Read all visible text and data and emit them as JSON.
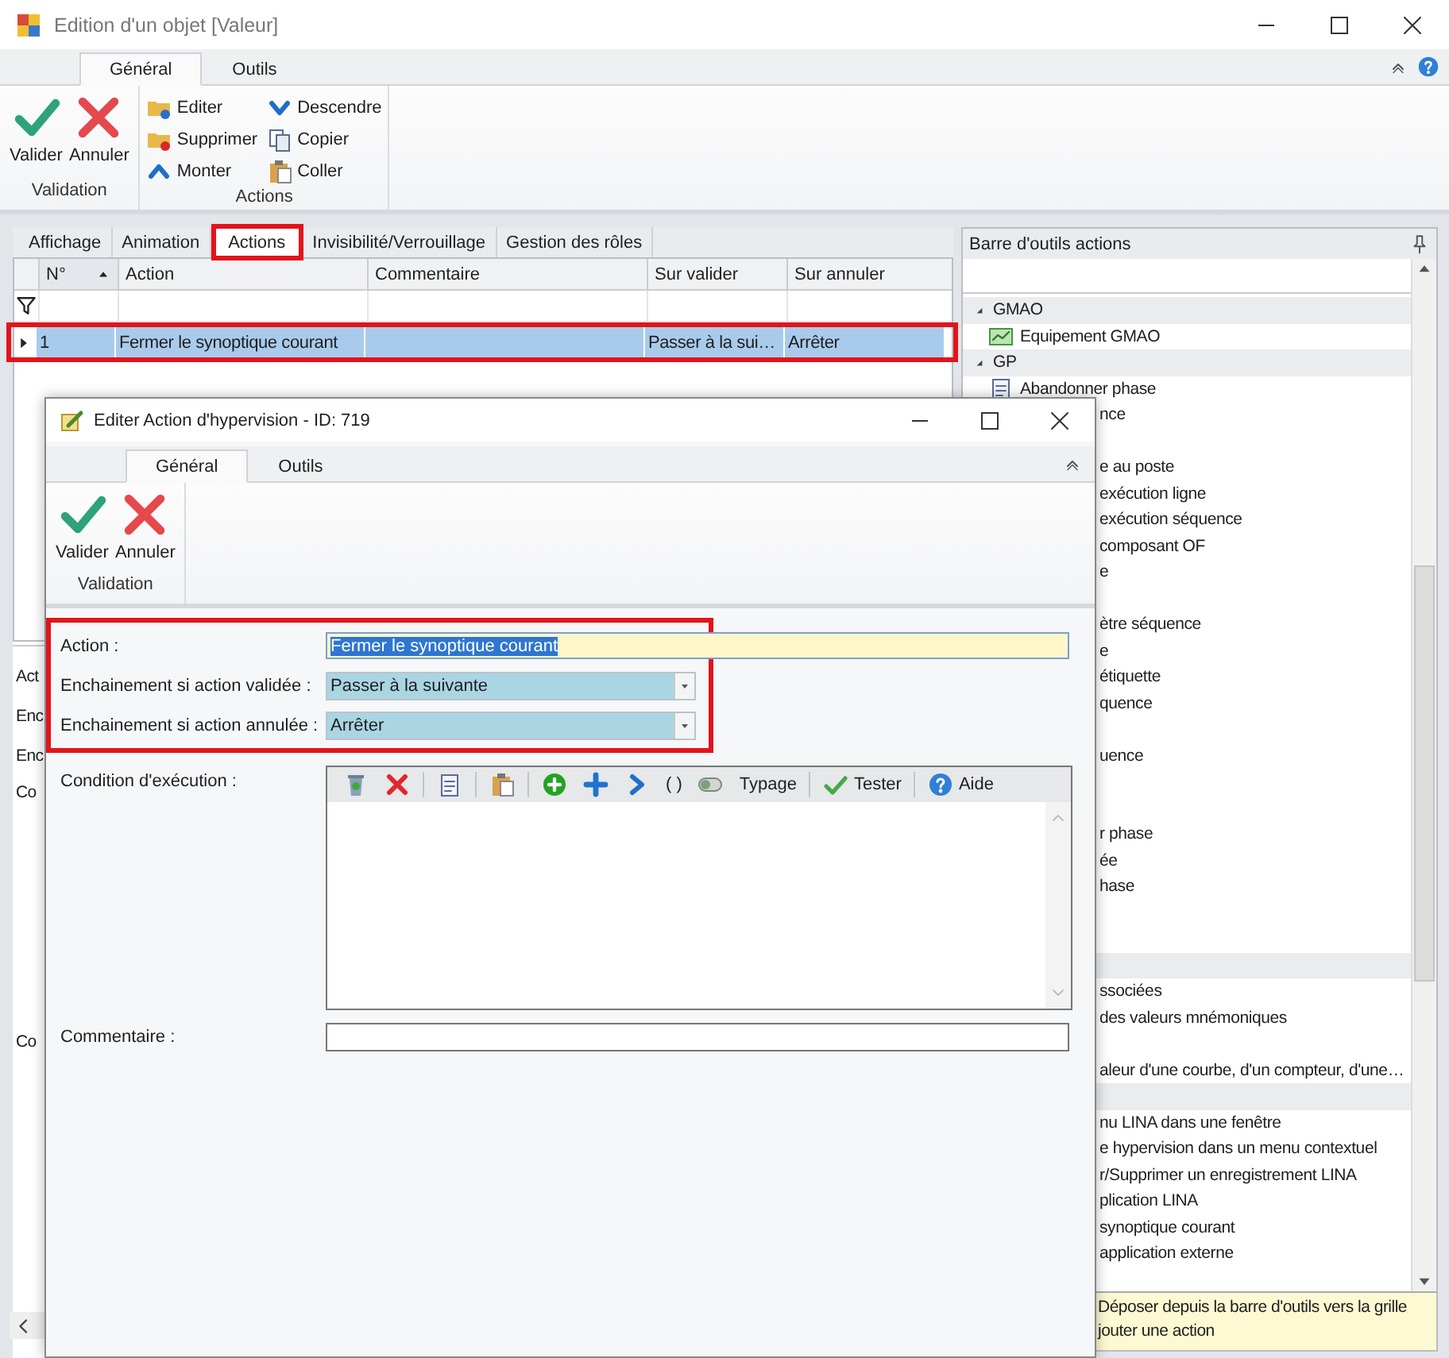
{
  "window": {
    "title": "Edition d'un objet [Valeur]"
  },
  "ribbon": {
    "tabs": [
      {
        "label": "Général",
        "selected": true
      },
      {
        "label": "Outils",
        "selected": false
      }
    ],
    "groups": [
      {
        "label": "Validation",
        "kind": "large",
        "buttons": [
          {
            "label": "Valider"
          },
          {
            "label": "Annuler"
          }
        ]
      },
      {
        "label": "Actions",
        "kind": "small",
        "buttons": [
          {
            "label": "Editer"
          },
          {
            "label": "Supprimer"
          },
          {
            "label": "Monter"
          },
          {
            "label": "Descendre"
          },
          {
            "label": "Copier"
          },
          {
            "label": "Coller"
          }
        ]
      }
    ]
  },
  "editor_tabs": [
    {
      "label": "Affichage",
      "selected": false,
      "highlighted": false
    },
    {
      "label": "Animation",
      "selected": false,
      "highlighted": false
    },
    {
      "label": "Actions",
      "selected": true,
      "highlighted": true
    },
    {
      "label": "Invisibilité/Verrouillage",
      "selected": false,
      "highlighted": false
    },
    {
      "label": "Gestion des rôles",
      "selected": false,
      "highlighted": false
    }
  ],
  "grid": {
    "columns": [
      {
        "label": "N°",
        "sorted": true
      },
      {
        "label": "Action",
        "sorted": false
      },
      {
        "label": "Commentaire",
        "sorted": false
      },
      {
        "label": "Sur valider",
        "sorted": false
      },
      {
        "label": "Sur annuler",
        "sorted": false
      }
    ],
    "rows": [
      {
        "selected": true,
        "highlighted": true,
        "cells": [
          "1",
          "Fermer le synoptique courant",
          null,
          "Passer à la sui…",
          "Arrêter"
        ]
      }
    ]
  },
  "background_form": {
    "fields": [
      {
        "label": "Act",
        "kind": "line"
      },
      {
        "label": "Enc",
        "kind": "line"
      },
      {
        "label": "Enc",
        "kind": "line"
      },
      {
        "label": "Co",
        "kind": "area"
      },
      {
        "label": "Co",
        "kind": "line"
      }
    ]
  },
  "toolbox": {
    "title": "Barre d'outils actions",
    "rows": [
      {
        "kind": "group",
        "label": "GMAO",
        "expanded": true
      },
      {
        "kind": "item",
        "label": "Equipement GMAO"
      },
      {
        "kind": "group",
        "label": "GP",
        "expanded": true
      },
      {
        "kind": "item",
        "label": "Abandonner phase"
      },
      {
        "kind": "clipped",
        "label": "nce"
      },
      {
        "kind": "blank"
      },
      {
        "kind": "clipped",
        "label": "e au poste"
      },
      {
        "kind": "clipped",
        "label": "exécution ligne"
      },
      {
        "kind": "clipped",
        "label": "exécution séquence"
      },
      {
        "kind": "clipped",
        "label": "composant OF"
      },
      {
        "kind": "clipped",
        "label": "e"
      },
      {
        "kind": "blank"
      },
      {
        "kind": "clipped",
        "label": "ètre séquence"
      },
      {
        "kind": "clipped",
        "label": "e"
      },
      {
        "kind": "clipped",
        "label": "étiquette"
      },
      {
        "kind": "clipped",
        "label": "quence"
      },
      {
        "kind": "blank"
      },
      {
        "kind": "clipped",
        "label": "uence"
      },
      {
        "kind": "blank"
      },
      {
        "kind": "blank"
      },
      {
        "kind": "clipped",
        "label": "r phase"
      },
      {
        "kind": "clipped",
        "label": "ée"
      },
      {
        "kind": "clipped",
        "label": "hase"
      },
      {
        "kind": "blank"
      },
      {
        "kind": "blank"
      },
      {
        "kind": "band"
      },
      {
        "kind": "clipped",
        "label": "ssociées"
      },
      {
        "kind": "clipped",
        "label": "des valeurs mnémoniques"
      },
      {
        "kind": "blank"
      },
      {
        "kind": "clipped",
        "label": "aleur d'une courbe, d'un compteur, d'une…"
      },
      {
        "kind": "band"
      },
      {
        "kind": "clipped",
        "label": "nu LINA dans une fenêtre"
      },
      {
        "kind": "clipped",
        "label": "e hypervision dans un menu contextuel"
      },
      {
        "kind": "clipped",
        "label": "r/Supprimer un enregistrement LINA"
      },
      {
        "kind": "clipped",
        "label": "plication LINA"
      },
      {
        "kind": "clipped",
        "label": "synoptique courant"
      },
      {
        "kind": "clipped",
        "label": "application externe"
      }
    ],
    "hint": [
      "Déposer depuis la barre d'outils vers la grille",
      "jouter une action"
    ]
  },
  "dialog": {
    "title": "Editer Action d'hypervision - ID: 719",
    "ribbon": {
      "tabs": [
        {
          "label": "Général",
          "selected": true
        },
        {
          "label": "Outils",
          "selected": false
        }
      ],
      "groups": [
        {
          "label": "Validation",
          "kind": "large",
          "buttons": [
            {
              "label": "Valider"
            },
            {
              "label": "Annuler"
            }
          ]
        }
      ]
    },
    "form_groups": [
      {
        "highlighted": true,
        "fields": [
          {
            "kind": "text",
            "label": "Action :",
            "value": "Fermer le synoptique courant",
            "focused": true,
            "text_selected": true
          },
          {
            "kind": "select",
            "label": "Enchainement si action validée :",
            "value": "Passer à la suivante"
          },
          {
            "kind": "select",
            "label": "Enchainement si action annulée :",
            "value": "Arrêter"
          }
        ]
      },
      {
        "highlighted": false,
        "fields": [
          {
            "kind": "editor",
            "label": "Condition d'exécution :",
            "toolbar": [
              {
                "kind": "icon"
              },
              {
                "kind": "icon"
              },
              {
                "kind": "sep"
              },
              {
                "kind": "icon"
              },
              {
                "kind": "sep"
              },
              {
                "kind": "icon"
              },
              {
                "kind": "sep"
              },
              {
                "kind": "icon"
              },
              {
                "kind": "icon"
              },
              {
                "kind": "icon"
              },
              {
                "kind": "text",
                "label": "( )"
              },
              {
                "kind": "icon"
              },
              {
                "kind": "text",
                "label": "Typage"
              },
              {
                "kind": "sep"
              },
              {
                "kind": "button",
                "label": "Tester"
              },
              {
                "kind": "sep"
              },
              {
                "kind": "button",
                "label": "Aide"
              }
            ]
          },
          {
            "kind": "comment",
            "label": "Commentaire :"
          }
        ]
      }
    ]
  }
}
